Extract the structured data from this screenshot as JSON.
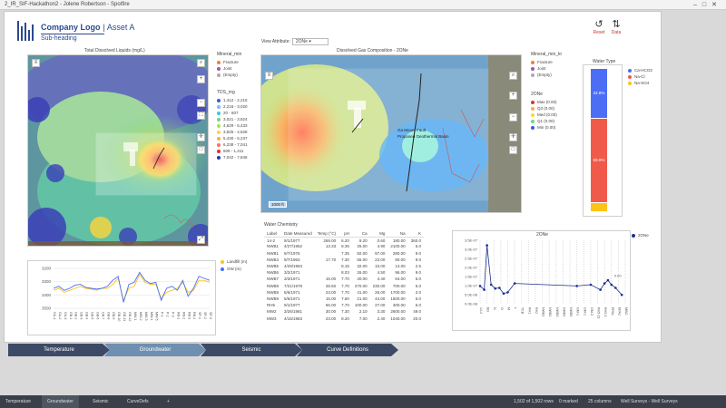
{
  "window": {
    "title": "2_IR_SIF-Hackathon2 - Jolene Robertson - Spotfire"
  },
  "header": {
    "logo_text": "Company Logo",
    "asset": "| Asset A",
    "subheading": "Sub-heading",
    "reset_label": "Reset",
    "data_label": "Data"
  },
  "tds_map": {
    "title": "Total Dissolved Liquids (mg/L)",
    "legend1_title": "Mineral_min",
    "legend1": [
      {
        "label": "Fracture",
        "color": "#e8833a"
      },
      {
        "label": "Joint",
        "color": "#9b59b6"
      },
      {
        "label": "(Empty)",
        "color": "#aaaaaa"
      }
    ],
    "legend2_title": "TDS_mg",
    "legend2": [
      {
        "label": "1,412 - 2,215",
        "color": "#3b5bdb"
      },
      {
        "label": "2,216 - 3,020",
        "color": "#74c0fc"
      },
      {
        "label": "20 - 607",
        "color": "#3bc9db"
      },
      {
        "label": "3,021 - 3,824",
        "color": "#69db7c"
      },
      {
        "label": "4,629 - 5,433",
        "color": "#a9e34b"
      },
      {
        "label": "3,825 - 4,628",
        "color": "#ffd43b"
      },
      {
        "label": "5,430 - 6,237",
        "color": "#ffa94d"
      },
      {
        "label": "6,238 - 7,041",
        "color": "#ff6b6b"
      },
      {
        "label": "608 - 1,411",
        "color": "#e03131"
      },
      {
        "label": "7,042 - 7,846",
        "color": "#1c3faa"
      }
    ]
  },
  "lithology_chart": {
    "legend": [
      "Landfill (m)",
      "GW (m)"
    ],
    "y_ticks": [
      "3200",
      "3300",
      "3400",
      "3500"
    ],
    "x_labels": [
      "GA-1",
      "GA-2",
      "GA-3",
      "GB-1",
      "GB-2",
      "GB-3",
      "GB-4",
      "GB-5",
      "GB-6",
      "GB-7",
      "GB-8",
      "GB-9",
      "GB-10",
      "GB-11",
      "GB-12",
      "MW-1",
      "MW-2",
      "MW-3",
      "MW-4",
      "MW-5",
      "P-1",
      "P-2",
      "P-3",
      "RB-1",
      "RB-2",
      "RB-3",
      "RB-4",
      "SP-1",
      "SP-2",
      "SP-3"
    ]
  },
  "gas_map": {
    "view_label": "View Attribute:",
    "view_value": "2ONe",
    "title": "Dissolved Gas Composition - 2ONe",
    "label1": "Ga Mount Fault",
    "label2": "Proposed Geothermal Basin",
    "scale": "1000 ft",
    "legend1_title": "Mineral_min_kr",
    "legend1": [
      {
        "label": "Fracture",
        "color": "#e8833a"
      },
      {
        "label": "Joint",
        "color": "#9b59b6"
      },
      {
        "label": "(Empty)",
        "color": "#aaaaaa"
      }
    ],
    "legend2_title": "2ONe",
    "legend2": [
      {
        "label": "Max (0.00)",
        "color": "#e03131"
      },
      {
        "label": "Q3 (0.00)",
        "color": "#ffa94d"
      },
      {
        "label": "Med (0.00)",
        "color": "#ffd43b"
      },
      {
        "label": "Q1 (0.00)",
        "color": "#69db7c"
      },
      {
        "label": "Min (0.00)",
        "color": "#3b5bdb"
      }
    ]
  },
  "water_type": {
    "title": "Water Type",
    "legend": [
      {
        "label": "Ca-HCO3",
        "color": "#4c6ef5"
      },
      {
        "label": "Na-Cl",
        "color": "#f05a4a"
      },
      {
        "label": "Na-SO4",
        "color": "#fcc419"
      }
    ],
    "segments": [
      {
        "label": "34.8%",
        "pct": 34.8,
        "color": "#4c6ef5"
      },
      {
        "label": "58.9%",
        "pct": 58.9,
        "color": "#f05a4a"
      },
      {
        "label": "",
        "pct": 6.3,
        "color": "#fcc419"
      }
    ]
  },
  "water_chemistry": {
    "title": "Water Chemistry",
    "columns": [
      "Label",
      "Date Measured",
      "Temp (°C)",
      "pH",
      "Ca",
      "Mg",
      "Na",
      "K"
    ],
    "rows": [
      [
        "14-2",
        "9/1/1977",
        "268.00",
        "6.20",
        "9.20",
        "0.60",
        "180.00",
        "360.0"
      ],
      [
        "NWB1",
        "4/27/1962",
        "13.33",
        "8.35",
        "25.00",
        "4.90",
        "2100.00",
        "5.0"
      ],
      [
        "NWB1",
        "9/7/1976",
        "",
        "7.35",
        "92.00",
        "97.00",
        "280.00",
        "9.0"
      ],
      [
        "NWB3",
        "9/7/1963",
        "17.70",
        "7.30",
        "56.00",
        "23.00",
        "80.00",
        "9.0"
      ],
      [
        "NWB5",
        "4/29/1963",
        "",
        "8.15",
        "32.00",
        "10.00",
        "13.00",
        "2.5"
      ],
      [
        "NWB6",
        "3/2/1971",
        "",
        "8.03",
        "26.00",
        "4.50",
        "96.00",
        "9.0"
      ],
      [
        "NWB7",
        "3/3/1971",
        "15.00",
        "7.70",
        "40.00",
        "4.40",
        "64.00",
        "5.0"
      ],
      [
        "NWB8",
        "7/21/1978",
        "28.50",
        "7.70",
        "270.00",
        "230.00",
        "700.00",
        "5.0"
      ],
      [
        "NWB8",
        "5/6/1971",
        "23.00",
        "7.70",
        "41.00",
        "26.00",
        "1700.00",
        "2.0"
      ],
      [
        "NWB9",
        "5/6/1971",
        "15.00",
        "7.60",
        "21.00",
        "44.00",
        "1500.00",
        "5.0"
      ],
      [
        "RH5",
        "9/1/1977",
        "66.00",
        "7.70",
        "100.00",
        "27.00",
        "300.00",
        "6.0"
      ],
      [
        "MW2",
        "3/26/1981",
        "30.00",
        "7.30",
        "2.10",
        "3.30",
        "2600.00",
        "49.0"
      ],
      [
        "MW3",
        "4/15/1983",
        "23.00",
        "8.20",
        "7.00",
        "2.40",
        "1040.00",
        "20.0"
      ]
    ]
  },
  "ts_chart": {
    "title": "2ONe",
    "legend": "2ONe",
    "y_ticks": [
      "3.5E-07",
      "3.0E-07",
      "2.5E-07",
      "2.0E-07",
      "1.5E-07",
      "1.0E-07",
      "5.0E-08",
      "0.0E-08"
    ],
    "x_labels": [
      "14-2",
      "BG",
      "N",
      "O",
      "M",
      "L",
      "TCB",
      "RH1",
      "RH2",
      "NWB1",
      "NWB2",
      "NWB3",
      "NWB4",
      "NWB5",
      "GM-1",
      "GM-2",
      "GM-3",
      "RH5-23",
      "RH5-3",
      "EPA1",
      "EPA2",
      "MW2"
    ],
    "annotation": "0.00"
  },
  "tabs": [
    "Temperature",
    "Groundwater",
    "Seismic",
    "Curve Definitions"
  ],
  "bottom": {
    "tabs": [
      "Temperature",
      "Groundwater",
      "Seismic",
      "CurveDefs"
    ],
    "add": "+",
    "status": [
      "1,502 of 1,502 rows",
      "0 marked",
      "25 columns",
      "Well Surveys - Well Surveys"
    ]
  }
}
